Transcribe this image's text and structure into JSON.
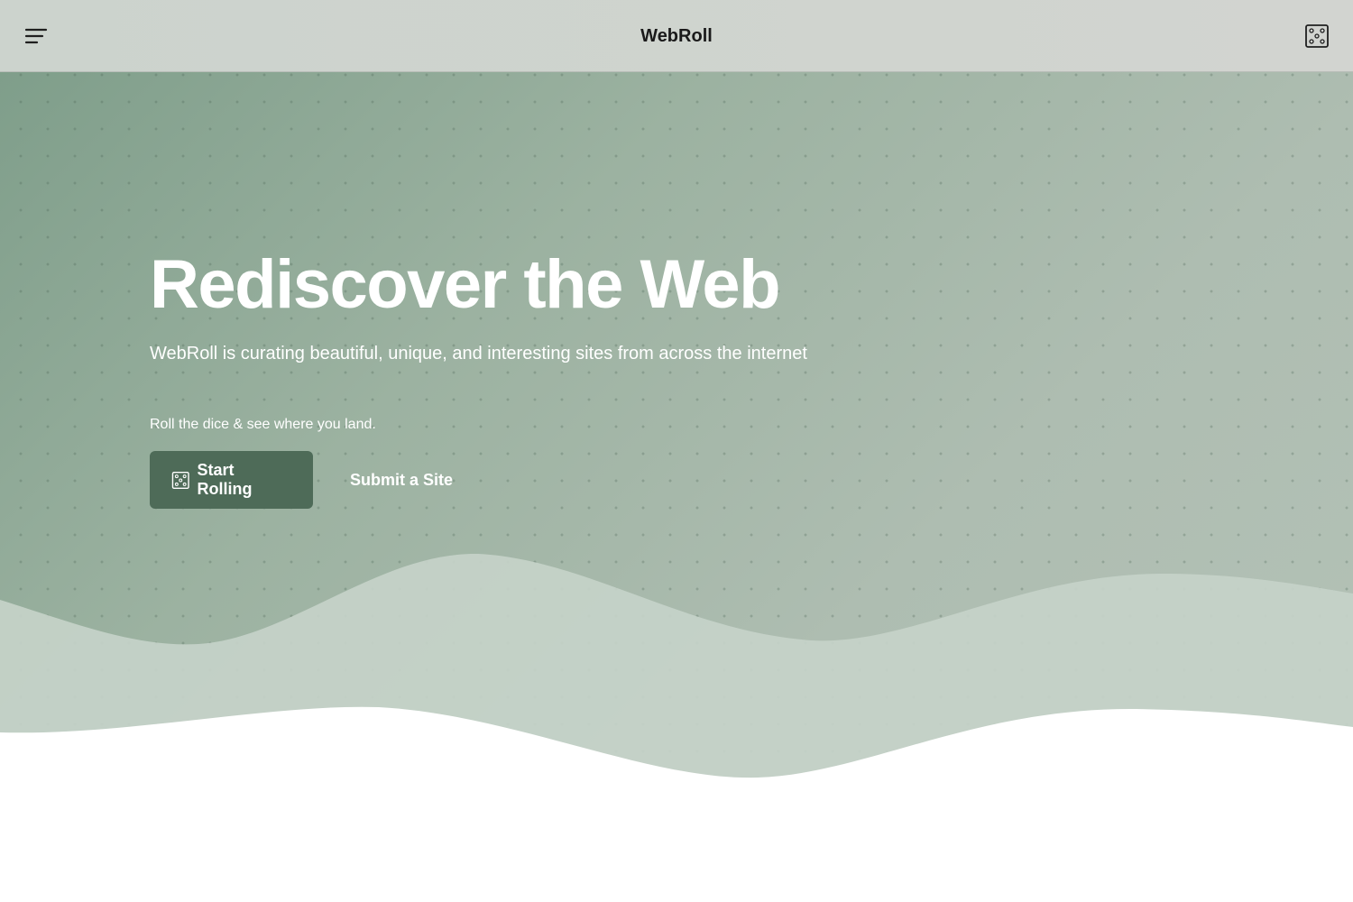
{
  "header": {
    "brand": "WebRoll",
    "menu_icon": "menu-icon",
    "dice_icon": "dice-icon"
  },
  "hero": {
    "headline": "Rediscover the Web",
    "subhead": "WebRoll is curating beautiful, unique, and interesting sites from across the internet",
    "tagline": "Roll the dice & see where you land.",
    "primary_button": {
      "label": "Start Rolling",
      "icon": "dice-icon"
    },
    "secondary_button": {
      "label": "Submit a Site"
    }
  },
  "colors": {
    "accent": "#4e6b58",
    "hero_start": "#7c9c88",
    "hero_end": "#b4c2b7",
    "header_bg": "#cfd4cf"
  }
}
